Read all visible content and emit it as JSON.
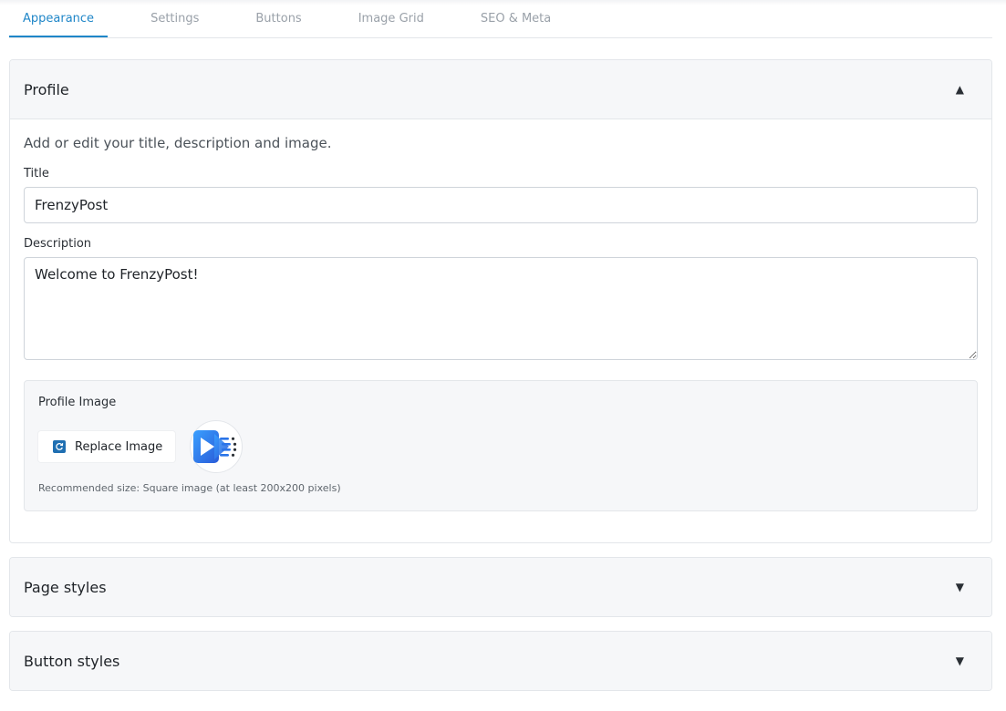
{
  "tabs": [
    {
      "label": "Appearance",
      "active": true
    },
    {
      "label": "Settings",
      "active": false
    },
    {
      "label": "Buttons",
      "active": false
    },
    {
      "label": "Image Grid",
      "active": false
    },
    {
      "label": "SEO & Meta",
      "active": false
    }
  ],
  "profile": {
    "header": "Profile",
    "expanded": true,
    "intro": "Add or edit your title, description and image.",
    "title_label": "Title",
    "title_value": "FrenzyPost",
    "description_label": "Description",
    "description_value": "Welcome to FrenzyPost!",
    "image_label": "Profile Image",
    "replace_button": "Replace Image",
    "hint": "Recommended size: Square image (at least 200x200 pixels)"
  },
  "page_styles": {
    "header": "Page styles",
    "expanded": false
  },
  "button_styles": {
    "header": "Button styles",
    "expanded": false
  },
  "icons": {
    "collapse": "caret-up-icon",
    "expand": "caret-down-icon",
    "replace": "refresh-icon",
    "avatar": "video-play-logo"
  },
  "colors": {
    "accent": "#1f86c8",
    "panel_header_bg": "#f6f7f9",
    "border": "#e3e6ea",
    "logo_blue": "#2f7ff0"
  }
}
